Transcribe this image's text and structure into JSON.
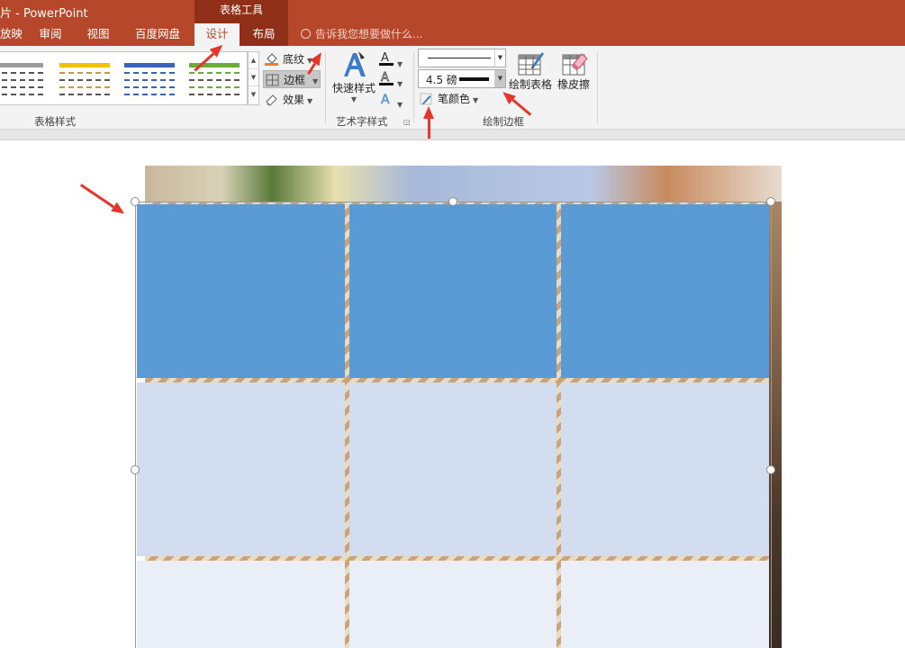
{
  "window": {
    "title": "片 - PowerPoint",
    "contextual_group": "表格工具"
  },
  "tabs": [
    "放映",
    "审阅",
    "视图",
    "百度网盘",
    "设计",
    "布局"
  ],
  "tell_me": "告诉我您想要做什么...",
  "ribbon": {
    "table_styles": {
      "label": "表格样式"
    },
    "shading": "底纹",
    "borders": "边框",
    "effects": "效果",
    "wordart": {
      "quick_styles": "快速样式",
      "label": "艺术字样式"
    },
    "draw_borders": {
      "label": "绘制边框",
      "pen_weight": "4.5 磅",
      "pen_color": "笔颜色",
      "draw_table": "绘制表格",
      "eraser": "橡皮擦"
    }
  },
  "colors": {
    "accent": "#b7472a",
    "context_tab": "#8f2f17",
    "table_header": "#5b9bd5",
    "table_band1": "#d2ddef",
    "table_band2": "#e9eef7",
    "annotation_arrow": "#e8352b"
  },
  "table": {
    "rows": 3,
    "cols": 3,
    "row_types": [
      "header",
      "band1",
      "band2"
    ]
  }
}
